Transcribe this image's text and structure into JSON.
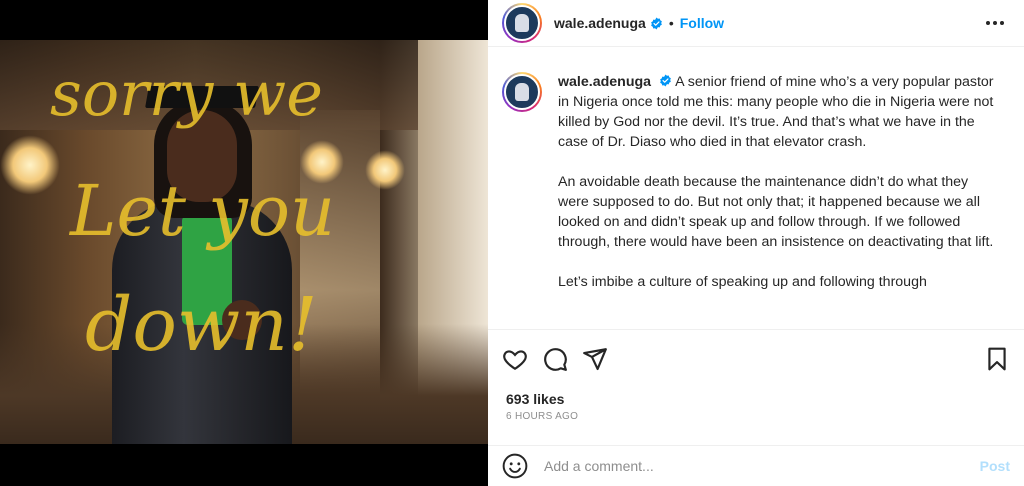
{
  "post": {
    "username": "wale.adenuga",
    "follow_label": "Follow",
    "dot": "•",
    "image": {
      "scribble_lines": [
        "sorry we",
        "Let you",
        "down!"
      ]
    },
    "caption": {
      "username": "wale.adenuga",
      "paragraphs": [
        "A senior friend of mine who’s a very popular pastor in Nigeria once told me this: many people who die in Nigeria were not killed by God nor the devil. It’s true. And that’s what we have in the case of Dr. Diaso who died in that elevator crash.",
        "An avoidable death because the maintenance didn’t do what they were supposed to do. But not only that; it happened because we all looked on and didn’t speak up and follow through. If we followed through, there would have been an insistence on deactivating that lift.",
        "Let’s imbibe a culture of speaking up and following through"
      ]
    },
    "likes": "693 likes",
    "time_ago": "6 HOURS AGO",
    "comment": {
      "placeholder": "Add a comment...",
      "post_label": "Post"
    },
    "colors": {
      "follow": "#0095f6",
      "post_disabled": "#b2dffc",
      "scribble": "#e7bf2c"
    },
    "icons": [
      "heart-icon",
      "comment-icon",
      "share-icon",
      "bookmark-icon",
      "emoji-icon",
      "more-icon",
      "verified-icon"
    ]
  }
}
